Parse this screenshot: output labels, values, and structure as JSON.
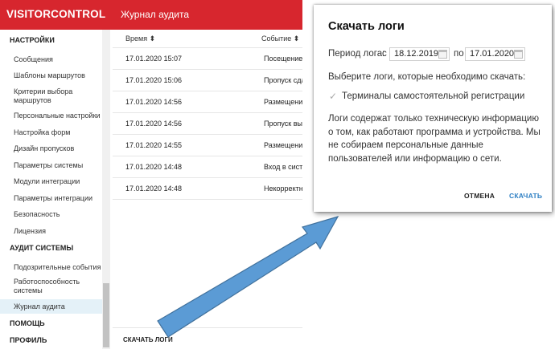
{
  "app": {
    "brand": "VISITORCONTROL",
    "title": "Журнал аудита"
  },
  "sidebar": {
    "section_settings": "НАСТРОЙКИ",
    "settings_items": [
      "Сообщения",
      "Шаблоны маршрутов",
      "Критерии выбора маршрутов",
      "Персональные настройки",
      "Настройка форм",
      "Дизайн пропусков",
      "Параметры системы",
      "Модули интеграции",
      "Параметры интеграции",
      "Безопасность",
      "Лицензия"
    ],
    "section_audit": "АУДИТ СИСТЕМЫ",
    "audit_items": [
      "Подозрительные события",
      "Работоспособность системы",
      "Журнал аудита"
    ],
    "section_help": "ПОМОЩЬ",
    "section_profile": "ПРОФИЛЬ"
  },
  "table": {
    "headers": {
      "time": "Время ⬍",
      "event": "Событие ⬍"
    },
    "rows": [
      {
        "time": "17.01.2020 15:07",
        "event": "Посещение о"
      },
      {
        "time": "17.01.2020 15:06",
        "event": "Пропуск сдан"
      },
      {
        "time": "17.01.2020 14:56",
        "event": "Размещение"
      },
      {
        "time": "17.01.2020 14:56",
        "event": "Пропуск выд"
      },
      {
        "time": "17.01.2020 14:55",
        "event": "Размещение"
      },
      {
        "time": "17.01.2020 14:48",
        "event": "Вход в систе"
      },
      {
        "time": "17.01.2020 14:48",
        "event": "Некорректны"
      }
    ],
    "download_button": "СКАЧАТЬ ЛОГИ"
  },
  "dialog": {
    "title": "Скачать логи",
    "period_label": "Период лога:",
    "from_label": "с",
    "from_date": "18.12.2019",
    "to_label": "по",
    "to_date": "17.01.2020",
    "choose_label": "Выберите логи, которые необходимо скачать:",
    "checkbox_label": "Терминалы самостоятельной регистрации",
    "checkbox_checked": true,
    "info_text": "Логи содержат только техническую информацию о том, как работают программа и устройства. Мы не собираем персональные данные пользователей или информацию о сети.",
    "cancel_button": "ОТМЕНА",
    "ok_button": "СКАЧАТЬ"
  },
  "colors": {
    "brand_red": "#d7262e",
    "accent_blue": "#2f80c4",
    "arrow_fill": "#5b9bd5",
    "arrow_stroke": "#41719c",
    "active_item_bg": "#e4f1f8"
  }
}
